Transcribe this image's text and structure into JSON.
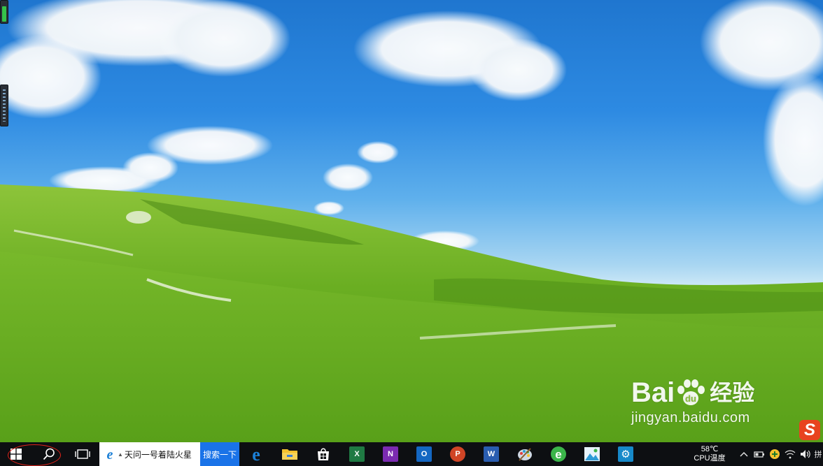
{
  "desktop": {
    "wallpaper": "green-hills-blue-sky",
    "sky_color": "#2d8ae2",
    "grass_color": "#5ea51c"
  },
  "watermark": {
    "logo_text_left": "Bai",
    "logo_text_right": "u",
    "logo_suffix": "经验",
    "url": "jingyan.baidu.com"
  },
  "sogou": {
    "label": "S",
    "color": "#e8431f"
  },
  "taskbar": {
    "start_icon": "windows-logo-icon",
    "search_icon": "search-icon",
    "task_view_icon": "task-view-icon",
    "ie_search": {
      "icon": "ie-icon",
      "text": "天问一号着陆火星",
      "button_label": "搜索一下"
    },
    "apps": [
      {
        "name": "edge",
        "icon": "edge-icon",
        "color": "#1b7fd6",
        "glyph": "e"
      },
      {
        "name": "file-explorer",
        "icon": "folder-icon",
        "color": "#f5c12e",
        "glyph": ""
      },
      {
        "name": "store",
        "icon": "store-icon",
        "color": "#ffffff",
        "glyph": ""
      },
      {
        "name": "excel",
        "icon": "excel-icon",
        "color": "#1f7a43",
        "glyph": "X"
      },
      {
        "name": "onenote",
        "icon": "onenote-icon",
        "color": "#7b2bb1",
        "glyph": "N"
      },
      {
        "name": "outlook",
        "icon": "outlook-icon",
        "color": "#1467c2",
        "glyph": "O"
      },
      {
        "name": "powerpoint",
        "icon": "powerpoint-icon",
        "color": "#d04526",
        "glyph": "P"
      },
      {
        "name": "word",
        "icon": "word-icon",
        "color": "#2a5db0",
        "glyph": "W"
      },
      {
        "name": "paint",
        "icon": "paint-palette-icon",
        "color": "#cfd8e3",
        "glyph": ""
      },
      {
        "name": "browser-360",
        "icon": "green-browser-icon",
        "color": "#3bb54a",
        "glyph": "e"
      },
      {
        "name": "photos",
        "icon": "photos-icon",
        "color": "#2e9bd6",
        "glyph": ""
      },
      {
        "name": "settings",
        "icon": "gear-icon",
        "color": "#1789c9",
        "glyph": "⚙"
      }
    ],
    "tray": {
      "temp_value": "58℃",
      "temp_label": "CPU温度",
      "icons": [
        "chevron-up-icon",
        "battery-icon",
        "yellow-plus-icon",
        "wifi-icon",
        "volume-icon",
        "ime-icon"
      ],
      "ime_label": "拼"
    }
  }
}
